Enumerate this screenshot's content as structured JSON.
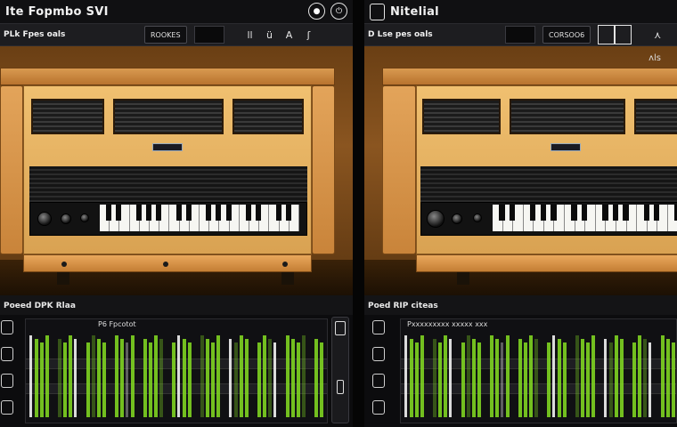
{
  "left_panel": {
    "title": "Ite Fopmbo SVI",
    "toolbar": {
      "preset": "PLk Fpes oals",
      "preset_button": "ROOKES",
      "icons": [
        "ll",
        "ü",
        "A",
        "ʃ"
      ]
    },
    "sequencer": {
      "label": "Poeed DPK Rlaa",
      "sublabel": "P6 Fpcotot"
    }
  },
  "right_panel": {
    "title": "Nitelial",
    "toolbar": {
      "preset": "D  Lse pes oals",
      "preset_button": "CORSOO6",
      "icons": [
        "⋏"
      ]
    },
    "side_glyph": "ʌls",
    "sequencer": {
      "label": "Poed RIP citeas",
      "sublabel": "Pxxxxxxxxx xxxxx xxx"
    }
  },
  "colors": {
    "wood": "#c9843a",
    "panel": "#141416",
    "step_green": "#7ed321",
    "step_white": "#f2f2f2"
  }
}
